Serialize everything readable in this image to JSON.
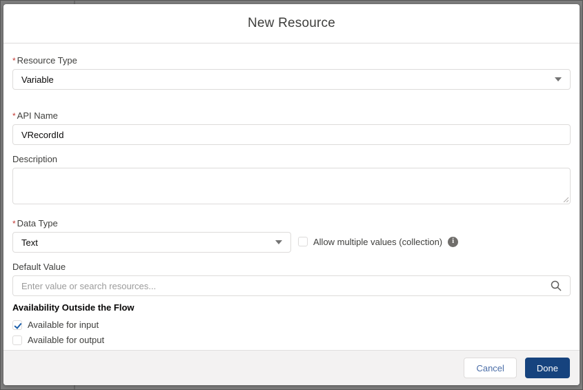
{
  "modal": {
    "title": "New Resource",
    "fields": {
      "resource_type": {
        "label": "Resource Type",
        "required": true,
        "value": "Variable"
      },
      "api_name": {
        "label": "API Name",
        "required": true,
        "value": "VRecordId"
      },
      "description": {
        "label": "Description",
        "value": ""
      },
      "data_type": {
        "label": "Data Type",
        "required": true,
        "value": "Text"
      },
      "allow_multiple": {
        "label": "Allow multiple values (collection)",
        "checked": false
      },
      "default_value": {
        "label": "Default Value",
        "value": "",
        "placeholder": "Enter value or search resources..."
      },
      "availability": {
        "heading": "Availability Outside the Flow",
        "options": [
          {
            "label": "Available for input",
            "checked": true
          },
          {
            "label": "Available for output",
            "checked": false
          }
        ]
      }
    },
    "footer": {
      "cancel_label": "Cancel",
      "done_label": "Done"
    },
    "colors": {
      "brand_button": "#16437e",
      "required_asterisk": "#c23934",
      "link_blue": "#4a6da7",
      "border": "#dddbda",
      "footer_bg": "#f3f2f2"
    }
  }
}
